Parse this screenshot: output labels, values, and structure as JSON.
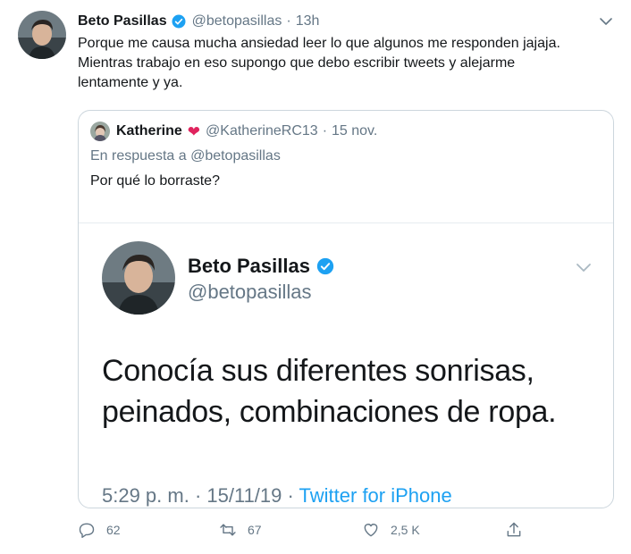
{
  "tweet": {
    "name": "Beto Pasillas",
    "handle": "@betopasillas",
    "separator": "·",
    "time": "13h",
    "lines": [
      "Porque me causa mucha ansiedad leer lo que algunos me responden jajaja.",
      "Mientras trabajo en eso supongo que debo escribir tweets y alejarme",
      "lentamente y ya."
    ]
  },
  "quoted": {
    "name": "Katherine",
    "heart": "❤",
    "handle": "@KatherineRC13",
    "separator": "·",
    "time": "15 nov.",
    "reply_to": "En respuesta a @betopasillas",
    "text": "Por qué lo borraste?"
  },
  "screenshot": {
    "name": "Beto Pasillas",
    "handle": "@betopasillas",
    "lines": [
      "Conocía sus diferentes sonrisas,",
      "peinados, combinaciones de ropa."
    ],
    "time": "5:29 p. m. · 15/11/19 · ",
    "source": "Twitter for iPhone"
  },
  "actions": {
    "replies": "62",
    "retweets": "67",
    "likes": "2,5 K"
  },
  "colors": {
    "verified": "#1da1f2",
    "heart": "#e0245e",
    "secondary_text": "#657786",
    "link": "#1da1f2"
  },
  "icons": {
    "verified": "verified-badge-icon",
    "caret": "chevron-down-icon",
    "reply": "reply-icon",
    "retweet": "retweet-icon",
    "like": "heart-outline-icon",
    "share": "share-icon"
  }
}
